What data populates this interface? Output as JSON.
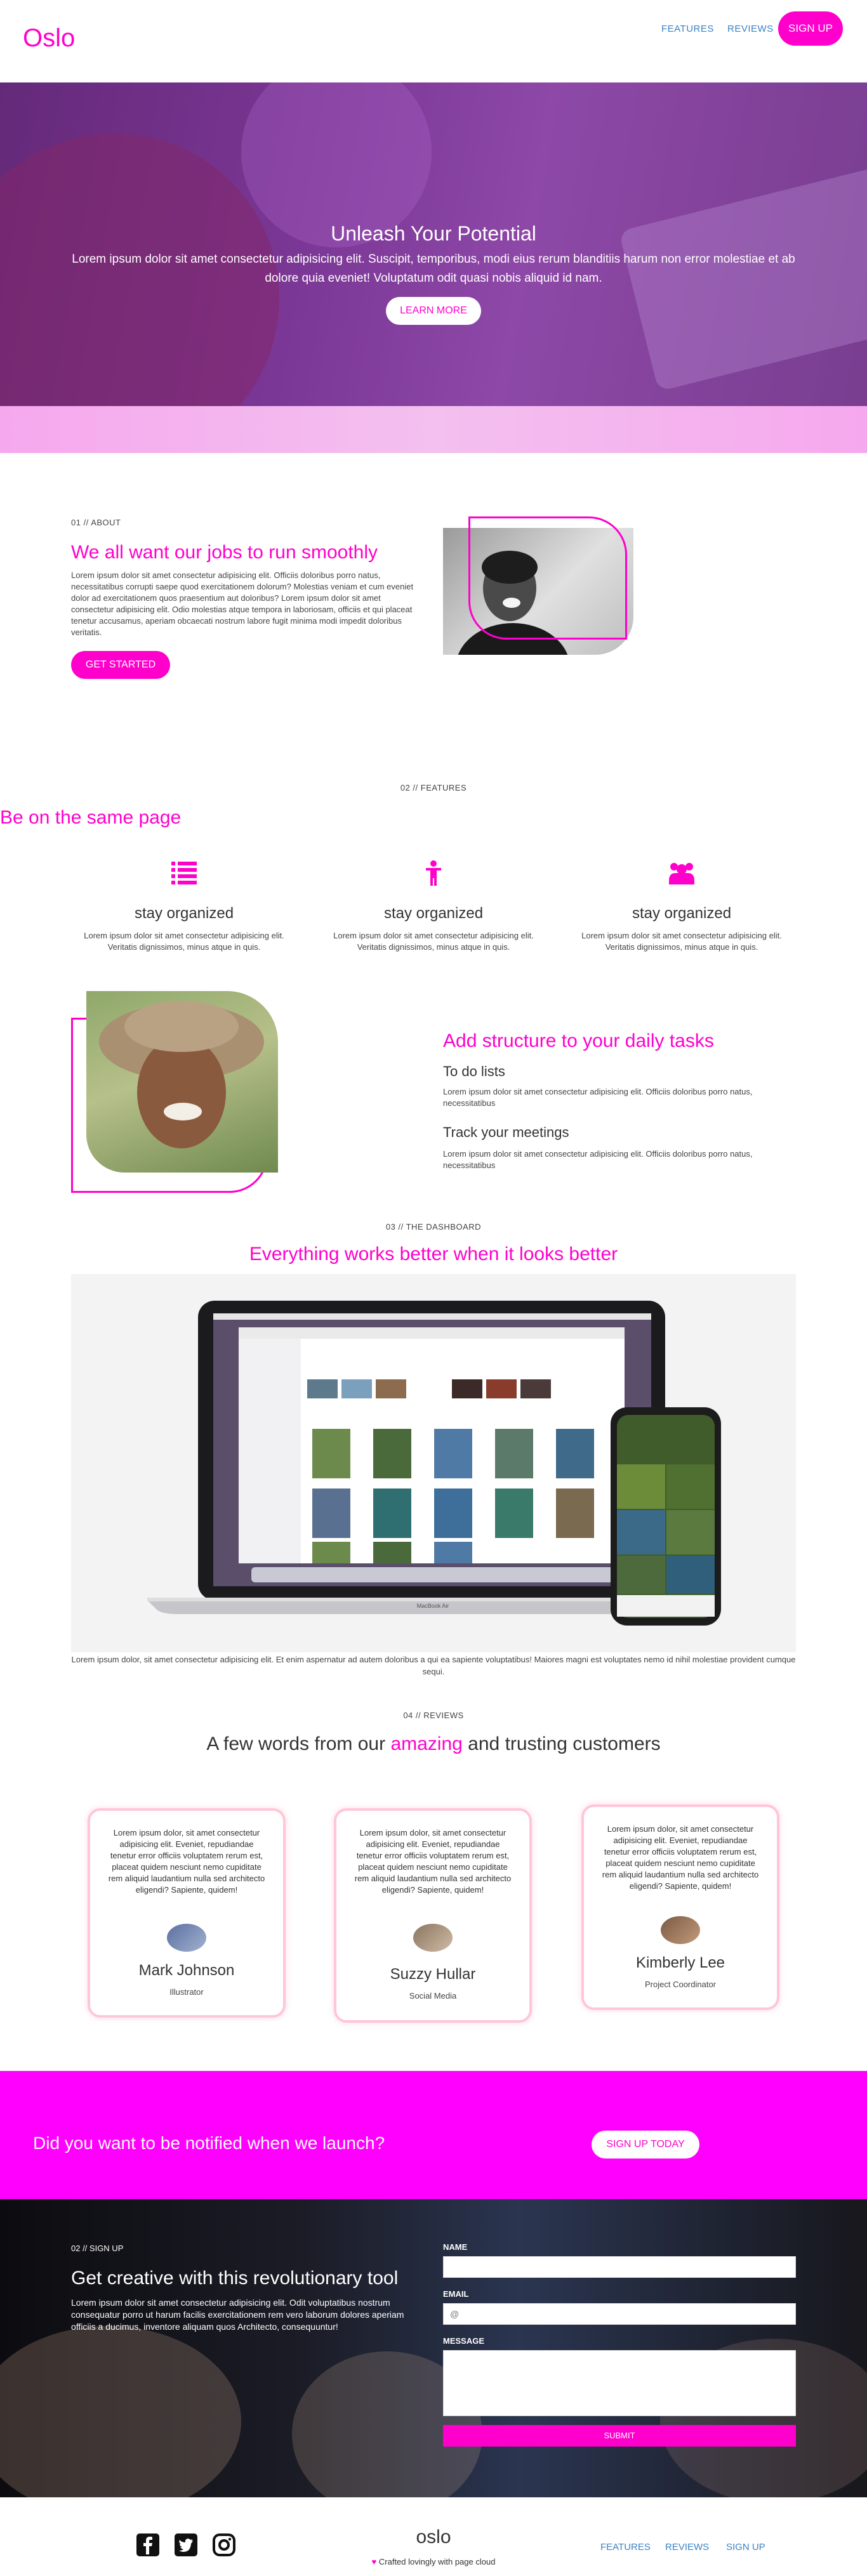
{
  "nav": {
    "logo": "Oslo",
    "links": [
      "FEATURES",
      "REVIEWS"
    ],
    "signup_label": "SIGN UP"
  },
  "hero": {
    "title": "Unleash Your Potential",
    "text": "Lorem ipsum dolor sit amet consectetur adipisicing elit. Suscipit, temporibus, modi eius rerum blanditiis harum non error molestiae et ab dolore quia eveniet! Voluptatum odit quasi nobis aliquid id nam.",
    "button_label": "LEARN MORE"
  },
  "about": {
    "eyebrow": "01 // ABOUT",
    "heading": "We all want our jobs to run smoothly",
    "text": "Lorem ipsum dolor sit amet consectetur adipisicing elit. Officiis doloribus porro natus, necessitatibus corrupti saepe quod exercitationem dolorum? Molestias veniam et cum eveniet dolor ad exercitationem quos praesentium aut doloribus? Lorem ipsum dolor sit amet consectetur adipisicing elit. Odio molestias atque tempora in laboriosam, officiis et qui placeat tenetur accusamus, aperiam obcaecati nostrum labore fugit minima modi impedit doloribus veritatis.",
    "button_label": "GET STARTED"
  },
  "features": {
    "eyebrow": "02 // FEATURES",
    "heading": "Be on the same page",
    "items": [
      {
        "icon": "list-icon",
        "title": "stay organized",
        "text": "Lorem ipsum dolor sit amet consectetur adipisicing elit. Veritatis dignissimos, minus atque in quis."
      },
      {
        "icon": "person-icon",
        "title": "stay organized",
        "text": "Lorem ipsum dolor sit amet consectetur adipisicing elit. Veritatis dignissimos, minus atque in quis."
      },
      {
        "icon": "users-icon",
        "title": "stay organized",
        "text": "Lorem ipsum dolor sit amet consectetur adipisicing elit. Veritatis dignissimos, minus atque in quis."
      }
    ]
  },
  "structure": {
    "heading": "Add structure to your daily tasks",
    "blocks": [
      {
        "title": "To do lists",
        "text": "Lorem ipsum dolor sit amet consectetur adipisicing elit. Officiis doloribus porro natus, necessitatibus"
      },
      {
        "title": "Track your meetings",
        "text": "Lorem ipsum dolor sit amet consectetur adipisicing elit. Officiis doloribus porro natus, necessitatibus"
      }
    ]
  },
  "dashboard": {
    "eyebrow": "03 // THE DASHBOARD",
    "heading": "Everything works better when it looks better",
    "laptop_label": "MacBook Air",
    "caption": "Lorem ipsum dolor, sit amet consectetur adipisicing elit. Et enim aspernatur ad autem doloribus a qui ea sapiente voluptatibus! Maiores magni est voluptates nemo id nihil molestiae provident cumque sequi."
  },
  "reviews": {
    "eyebrow": "04 // REVIEWS",
    "heading_before": "A few words from our ",
    "heading_highlight": "amazing",
    "heading_after": " and trusting customers",
    "items": [
      {
        "text": "Lorem ipsum dolor, sit amet consectetur adipisicing elit. Eveniet, repudiandae tenetur error officiis voluptatem rerum est, placeat quidem nesciunt nemo cupiditate rem aliquid laudantium nulla sed architecto eligendi? Sapiente, quidem!",
        "name": "Mark Johnson",
        "role": "Illustrator"
      },
      {
        "text": "Lorem ipsum dolor, sit amet consectetur adipisicing elit. Eveniet, repudiandae tenetur error officiis voluptatem rerum est, placeat quidem nesciunt nemo cupiditate rem aliquid laudantium nulla sed architecto eligendi? Sapiente, quidem!",
        "name": "Suzzy Hullar",
        "role": "Social Media"
      },
      {
        "text": "Lorem ipsum dolor, sit amet consectetur adipisicing elit. Eveniet, repudiandae tenetur error officiis voluptatem rerum est, placeat quidem nesciunt nemo cupiditate rem aliquid laudantium nulla sed architecto eligendi? Sapiente, quidem!",
        "name": "Kimberly Lee",
        "role": "Project Coordinator"
      }
    ]
  },
  "notify": {
    "heading": "Did you want to be notified when we launch?",
    "button_label": "SIGN UP TODAY"
  },
  "signup": {
    "eyebrow": "02 // SIGN UP",
    "heading": "Get creative with this revolutionary tool",
    "text": "Lorem ipsum dolor sit amet consectetur adipisicing elit. Odit voluptatibus nostrum consequatur porro ut harum facilis exercitationem rem vero laborum dolores aperiam officiis a ducimus, inventore aliquam quos Architecto, consequuntur!",
    "name_label": "NAME",
    "email_label": "EMAIL",
    "email_placeholder": "@",
    "message_label": "MESSAGE",
    "submit_label": "SUBMIT"
  },
  "footer": {
    "logo": "oslo",
    "credit": "Crafted lovingly with page cloud",
    "links": [
      "FEATURES",
      "REVIEWS",
      "SIGN UP"
    ],
    "social_icons": [
      "facebook-icon",
      "twitter-icon",
      "instagram-icon"
    ]
  },
  "colors": {
    "accent": "#ff00cc",
    "notify_band": "#ff00ff",
    "link": "#3b82c4"
  }
}
